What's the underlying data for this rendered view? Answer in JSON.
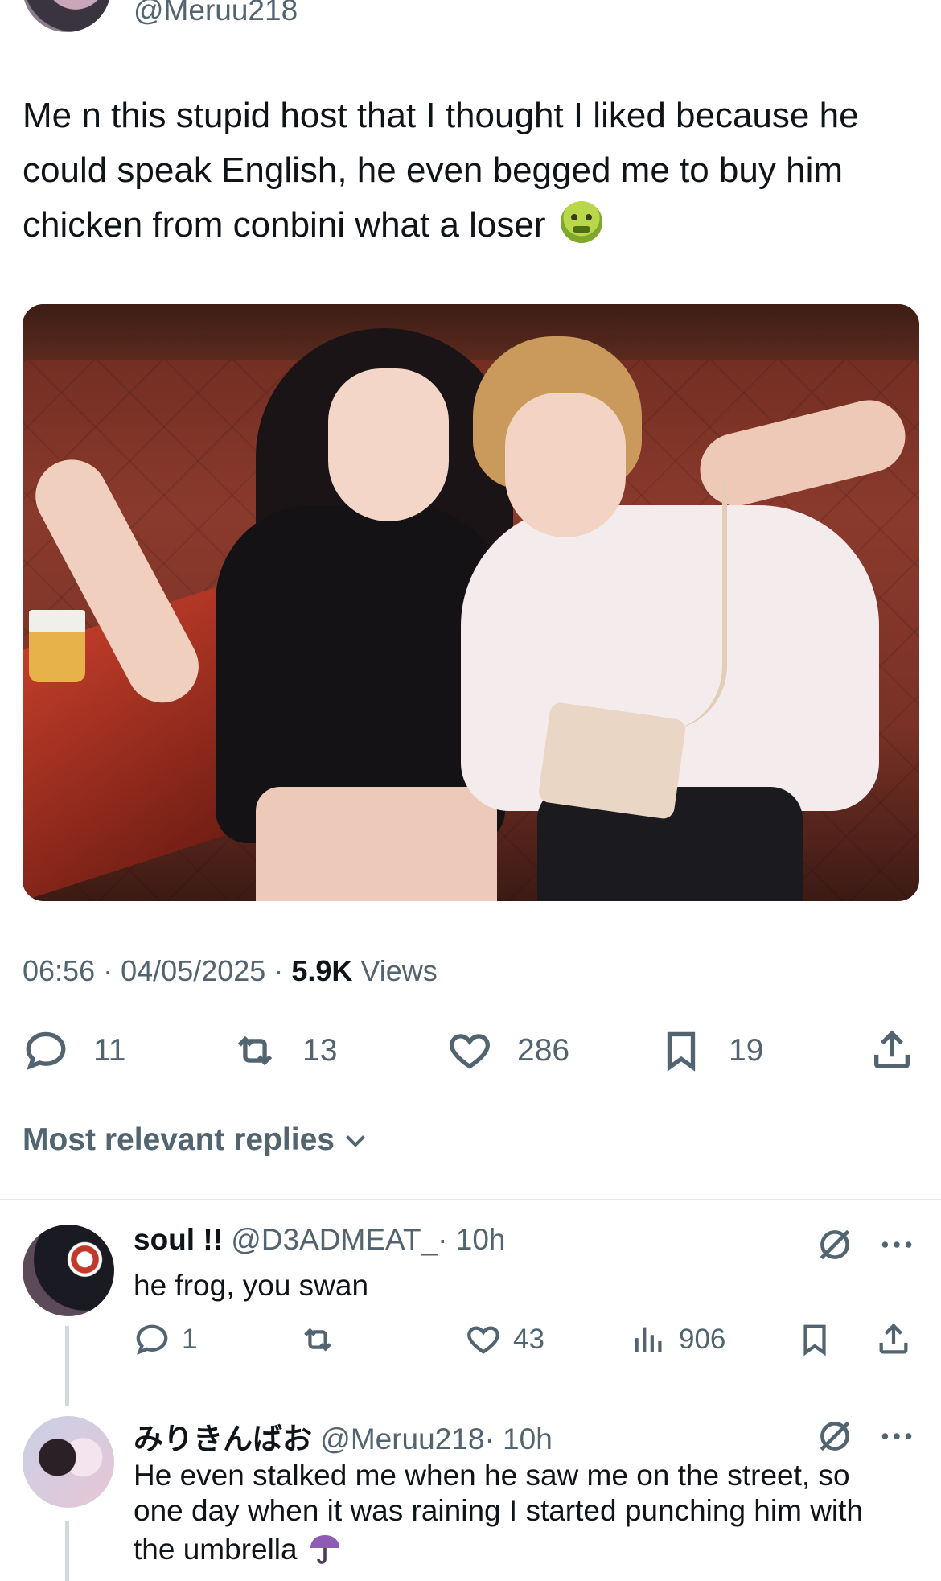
{
  "author": {
    "handle": "@Meruu218"
  },
  "tweet": {
    "text": "Me n this stupid host that I thought I liked because he could speak English, he even begged me to buy him chicken from conbini what a loser",
    "emoji": "nauseated-face",
    "time": "06:56",
    "date": "04/05/2025",
    "views_count": "5.9K",
    "views_label": "Views",
    "sep": "·"
  },
  "actions": {
    "replies": "11",
    "reposts": "13",
    "likes": "286",
    "bookmarks": "19"
  },
  "replies_section": {
    "title": "Most relevant replies"
  },
  "replies": [
    {
      "name": "soul !!",
      "handle": "@D3ADMEAT_",
      "time": "· 10h",
      "text": "he frog, you swan",
      "replies": "1",
      "likes": "43",
      "views": "906"
    },
    {
      "name": "みりきんばお",
      "handle": "@Meruu218",
      "time": "· 10h",
      "text": "He even stalked me when he saw me on the street, so one day when it was raining I started punching him with the umbrella",
      "emoji": "umbrella"
    }
  ],
  "colors": {
    "text": "#0f1419",
    "secondary": "#536471",
    "divider": "#e5e9ec"
  }
}
